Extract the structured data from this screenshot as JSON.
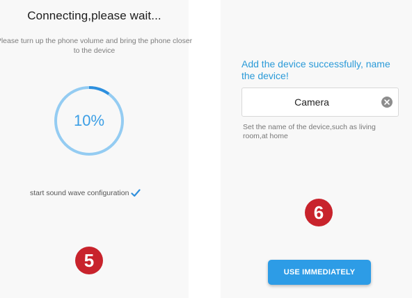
{
  "connecting_screen": {
    "title": "Connecting,please wait...",
    "instruction": "Please turn up the phone volume and bring the phone closer to the device",
    "progress": {
      "value": 0.1,
      "label": "10%"
    },
    "status_text": "start sound wave configuration",
    "status_icon": "checkmark-icon",
    "step_number": "5"
  },
  "naming_screen": {
    "success_message": "Add the device successfully, name the device!",
    "device_name_value": "Camera",
    "clear_icon": "clear-icon",
    "hint": "Set the name of the device,such as living room,at home",
    "button_label": "USE IMMEDIATELY",
    "step_number": "6"
  },
  "colors": {
    "accent": "#2d9ce6",
    "progress_ring": "#94ccf2",
    "badge": "#c8232c"
  }
}
